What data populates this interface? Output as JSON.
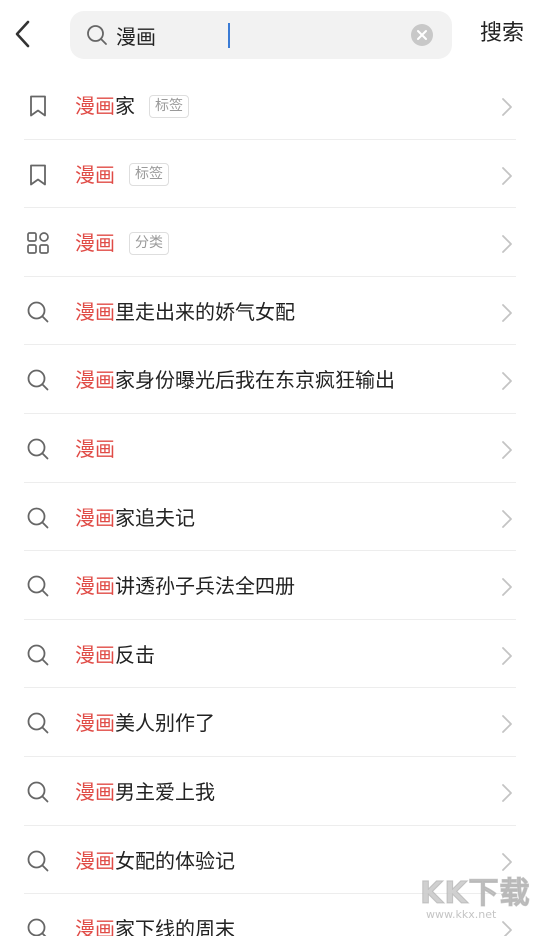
{
  "header": {
    "query": "漫画",
    "search_label": "搜索"
  },
  "highlight": "漫画",
  "rows": [
    {
      "icon": "bookmark-icon",
      "rest": "家",
      "tag": "标签"
    },
    {
      "icon": "bookmark-icon",
      "rest": "",
      "tag": "标签"
    },
    {
      "icon": "category-grid-icon",
      "rest": "",
      "tag": "分类"
    },
    {
      "icon": "search-icon",
      "rest": "里走出来的娇气女配",
      "tag": ""
    },
    {
      "icon": "search-icon",
      "rest": "家身份曝光后我在东京疯狂输出",
      "tag": ""
    },
    {
      "icon": "search-icon",
      "rest": "",
      "tag": ""
    },
    {
      "icon": "search-icon",
      "rest": "家追夫记",
      "tag": ""
    },
    {
      "icon": "search-icon",
      "rest": "讲透孙子兵法全四册",
      "tag": ""
    },
    {
      "icon": "search-icon",
      "rest": "反击",
      "tag": ""
    },
    {
      "icon": "search-icon",
      "rest": "美人别作了",
      "tag": ""
    },
    {
      "icon": "search-icon",
      "rest": "男主爱上我",
      "tag": ""
    },
    {
      "icon": "search-icon",
      "rest": "女配的体验记",
      "tag": ""
    },
    {
      "icon": "search-icon",
      "rest": "家下线的周末",
      "tag": ""
    }
  ],
  "colors": {
    "highlight": "#e04b46",
    "text": "#222222",
    "search_bg": "#f2f2f2",
    "divider": "#ededed"
  },
  "watermark": {
    "logo": "KK下载",
    "url": "www.kkx.net"
  }
}
